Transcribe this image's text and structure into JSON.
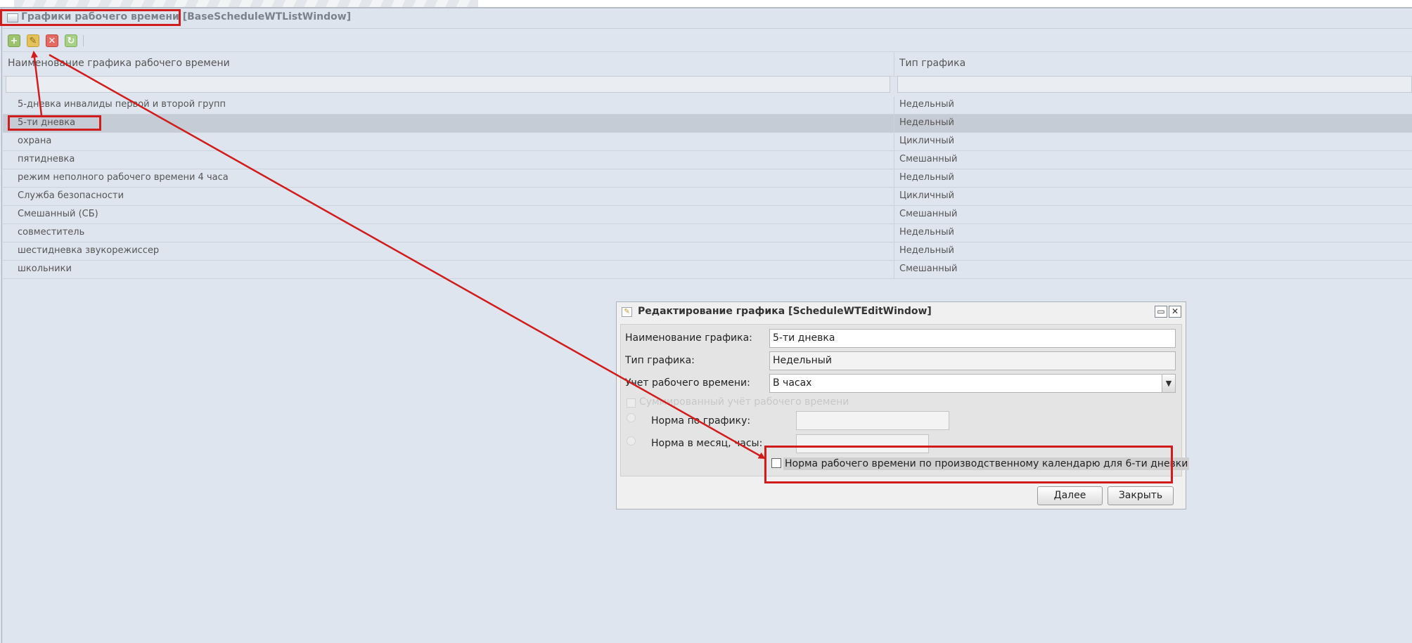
{
  "window": {
    "title": "Графики рабочего времени [BaseScheduleWTListWindow]"
  },
  "toolbar": {
    "add_icon": "add-icon",
    "edit_icon": "edit-icon",
    "delete_icon": "delete-icon",
    "refresh_icon": "refresh-icon"
  },
  "grid": {
    "columns": [
      "Наименование графика рабочего времени",
      "Тип графика"
    ],
    "rows": [
      {
        "name": "5-дневка инвалиды первой и второй групп",
        "type": "Недельный"
      },
      {
        "name": "5-ти дневка",
        "type": "Недельный"
      },
      {
        "name": "охрана",
        "type": "Цикличный"
      },
      {
        "name": "пятидневка",
        "type": "Смешанный"
      },
      {
        "name": "режим неполного рабочего времени 4 часа",
        "type": "Недельный"
      },
      {
        "name": "Служба безопасности",
        "type": "Цикличный"
      },
      {
        "name": "Смешанный (СБ)",
        "type": "Смешанный"
      },
      {
        "name": "совместитель",
        "type": "Недельный"
      },
      {
        "name": "шестидневка звукорежиссер",
        "type": "Недельный"
      },
      {
        "name": "школьники",
        "type": "Смешанный"
      }
    ]
  },
  "dialog": {
    "title": "Редактирование графика [ScheduleWTEditWindow]",
    "fields": {
      "name_label": "Наименование графика:",
      "name_value": "5-ти дневка",
      "type_label": "Тип графика:",
      "type_value": "Недельный",
      "accounting_label": "Учет рабочего времени:",
      "accounting_value": "В часах",
      "summarized_label": "Суммированный учёт рабочего времени",
      "norm_schedule_label": "Норма по графику:",
      "norm_month_label": "Норма в месяц, часы:",
      "calendar_norm_label": "Норма рабочего времени по производственному календарю для 6-ти дневки"
    },
    "buttons": {
      "next": "Далее",
      "close": "Закрыть"
    }
  },
  "colors": {
    "annotation": "#d01c1c",
    "background": "#dfe5ee",
    "selected_row": "#c6ccd5"
  }
}
